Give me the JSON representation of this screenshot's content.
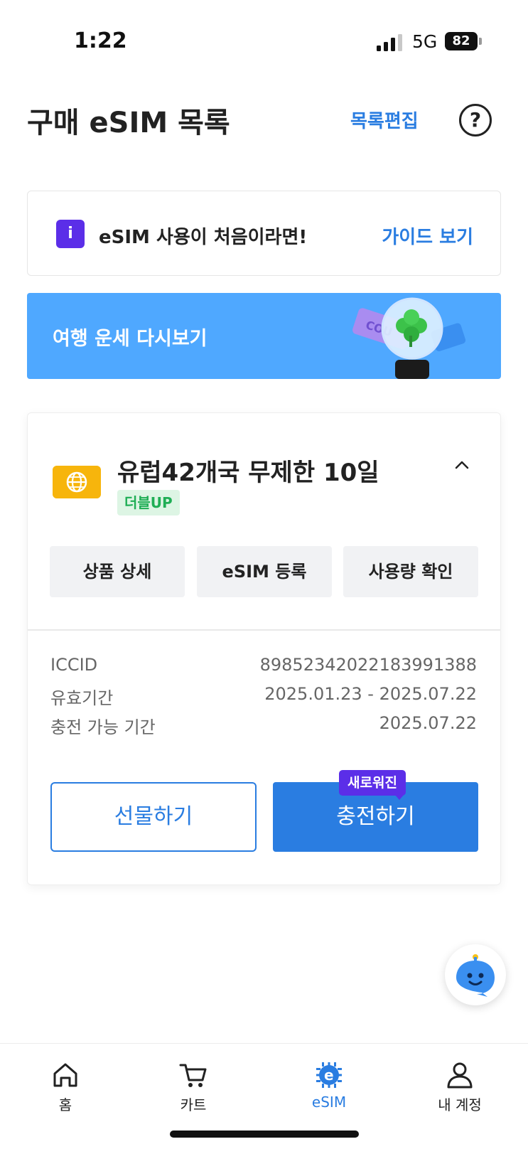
{
  "status_bar": {
    "time": "1:22",
    "network": "5G",
    "battery": "82"
  },
  "header": {
    "title": "구매 eSIM 목록",
    "edit_label": "목록편집",
    "help_glyph": "?"
  },
  "guide_banner": {
    "icon_letter": "i",
    "text": "eSIM 사용이 처음이라면!",
    "link": "가이드 보기"
  },
  "fortune_banner": {
    "text": "여행 운세 다시보기",
    "coupon_text": "COU"
  },
  "esim_card": {
    "product_name": "유럽42개국 무제한 10일",
    "badge": "더블UP",
    "actions": [
      "상품 상세",
      "eSIM 등록",
      "사용량 확인"
    ],
    "info": [
      {
        "label": "ICCID",
        "value": "8985234202218399138​8"
      },
      {
        "label": "유효기간",
        "value": "2025.01.23 - 2025.07.22"
      },
      {
        "label": "충전 가능 기간",
        "value": "2025.07.22"
      }
    ],
    "gift_label": "선물하기",
    "charge_label": "충전하기",
    "new_tag": "새로워진"
  },
  "tabbar": {
    "items": [
      {
        "label": "홈",
        "icon": "home-icon"
      },
      {
        "label": "카트",
        "icon": "cart-icon"
      },
      {
        "label": "eSIM",
        "icon": "esim-chip-icon"
      },
      {
        "label": "내 계정",
        "icon": "user-icon"
      }
    ],
    "active_index": 2
  },
  "colors": {
    "accent": "#2a7de1",
    "purple": "#5b2ee8",
    "banner_blue": "#4fa8ff",
    "badge_green": "#1fae55",
    "globe_yellow": "#f7b50c"
  }
}
